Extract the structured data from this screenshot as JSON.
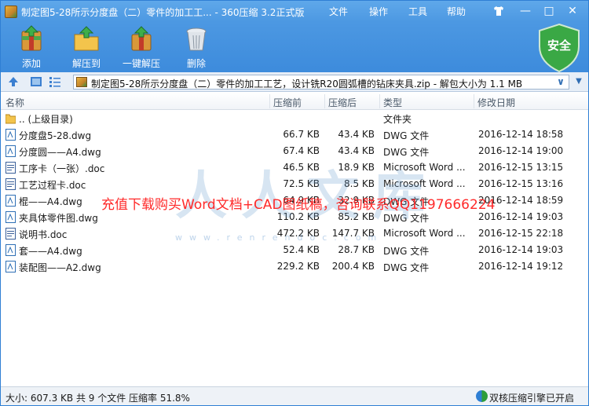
{
  "window": {
    "title": "制定图5-28所示分度盘（二）零件的加工工... - 360压缩 3.2正式版",
    "menu": [
      "文件",
      "操作",
      "工具",
      "帮助"
    ],
    "controls": {
      "skin": "shirt-icon",
      "minimize": "—",
      "maximize": "□",
      "close": "✕"
    }
  },
  "toolbar": {
    "add": "添加",
    "extract_to": "解压到",
    "one_click_extract": "一键解压",
    "delete": "删除",
    "security": "安全"
  },
  "address": {
    "path": "制定图5-28所示分度盘（二）零件的加工工艺，设计铣R20圆弧槽的钻床夹具.zip - 解包大小为 1.1 MB"
  },
  "columns": {
    "name": "名称",
    "packed": "压缩前",
    "unpacked": "压缩后",
    "type": "类型",
    "modified": "修改日期"
  },
  "files": [
    {
      "icon": "folder-up-icon",
      "name": ".. (上级目录)",
      "before": "",
      "after": "",
      "type": "文件夹",
      "date": ""
    },
    {
      "icon": "dwg-file-icon",
      "name": "分度盘5-28.dwg",
      "before": "66.7 KB",
      "after": "43.4 KB",
      "type": "DWG 文件",
      "date": "2016-12-14 18:58"
    },
    {
      "icon": "dwg-file-icon",
      "name": "分度圆——A4.dwg",
      "before": "67.4 KB",
      "after": "43.4 KB",
      "type": "DWG 文件",
      "date": "2016-12-14 19:00"
    },
    {
      "icon": "word-file-icon",
      "name": "工序卡（一张）.doc",
      "before": "46.5 KB",
      "after": "18.9 KB",
      "type": "Microsoft Word ...",
      "date": "2016-12-15 13:15"
    },
    {
      "icon": "word-file-icon",
      "name": "工艺过程卡.doc",
      "before": "72.5 KB",
      "after": "8.5 KB",
      "type": "Microsoft Word ...",
      "date": "2016-12-15 13:16"
    },
    {
      "icon": "dwg-file-icon",
      "name": "棍——A4.dwg",
      "before": "64.9 KB",
      "after": "32.9 KB",
      "type": "DWG 文件",
      "date": "2016-12-14 18:59"
    },
    {
      "icon": "dwg-file-icon",
      "name": "夹具体零件图.dwg",
      "before": "110.2 KB",
      "after": "85.2 KB",
      "type": "DWG 文件",
      "date": "2016-12-14 19:03"
    },
    {
      "icon": "word-file-icon",
      "name": "说明书.doc",
      "before": "472.2 KB",
      "after": "147.7 KB",
      "type": "Microsoft Word ...",
      "date": "2016-12-15 22:18"
    },
    {
      "icon": "dwg-file-icon",
      "name": "套——A4.dwg",
      "before": "52.4 KB",
      "after": "28.7 KB",
      "type": "DWG 文件",
      "date": "2016-12-14 19:03"
    },
    {
      "icon": "dwg-file-icon",
      "name": "装配图——A2.dwg",
      "before": "229.2 KB",
      "after": "200.4 KB",
      "type": "DWG 文件",
      "date": "2016-12-14 19:12"
    }
  ],
  "overlay": {
    "watermark": "人人文库",
    "watermark_url": "www.renrendoc.com",
    "promo": "充值下载购买Word文档+CAD图纸稿，咨询联系QQ1197666224"
  },
  "status": {
    "summary": "大小: 607.3 KB 共 9 个文件 压缩率 51.8%",
    "engine": "双核压缩引擎已开启"
  },
  "colors": {
    "accent": "#3d8bdc",
    "promo": "#ff2a2a",
    "shield": "#2e9d3a"
  }
}
